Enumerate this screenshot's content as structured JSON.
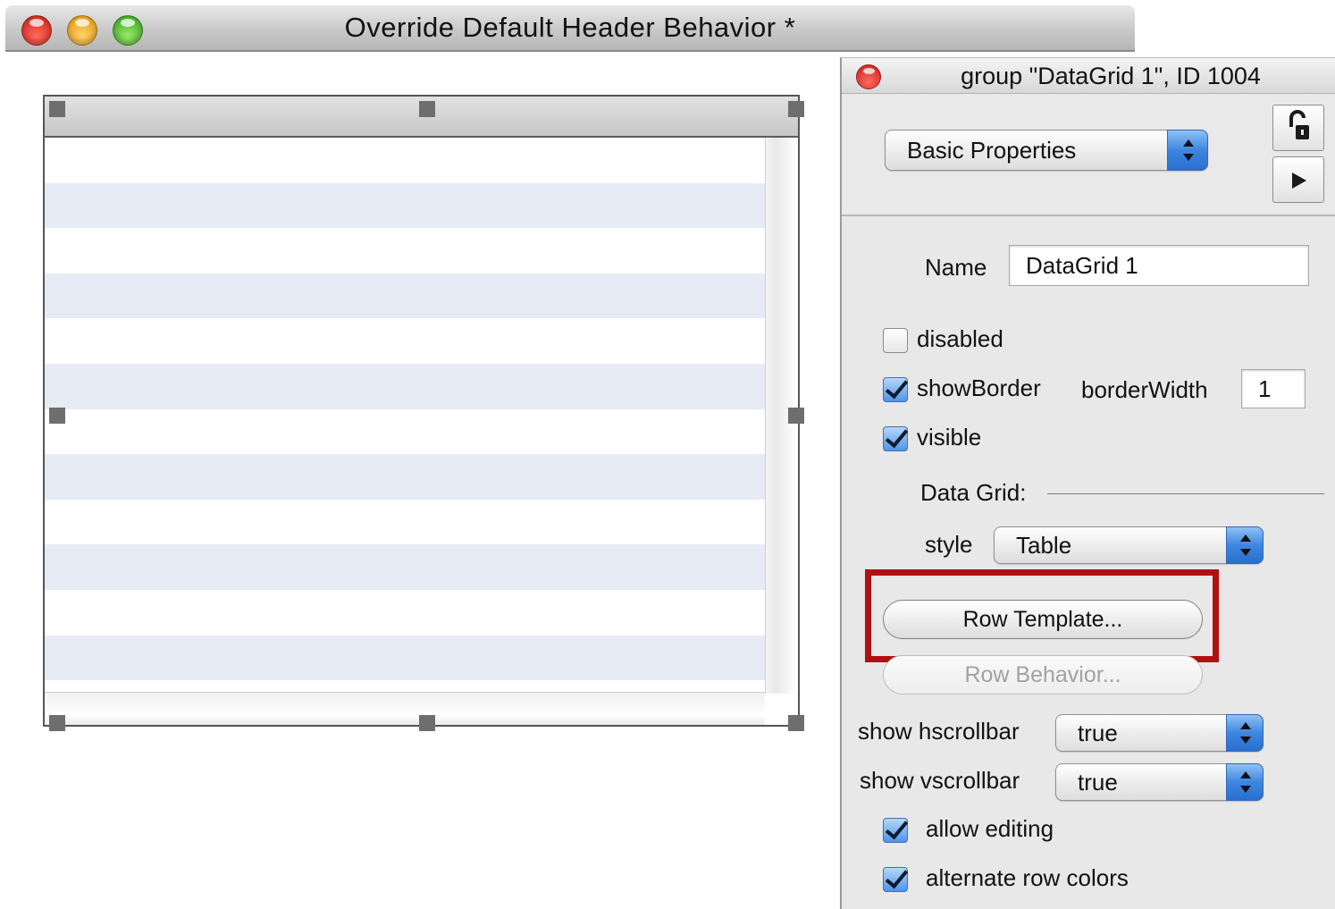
{
  "window": {
    "title": "Override Default Header Behavior *"
  },
  "inspector": {
    "title": "group \"DataGrid 1\", ID 1004",
    "panel_popup": "Basic Properties",
    "lock_icon": "unlock-icon",
    "play_icon": "play-icon",
    "name_label": "Name",
    "name_value": "DataGrid 1",
    "disabled": {
      "label": "disabled",
      "checked": false
    },
    "showBorder": {
      "label": "showBorder",
      "checked": true
    },
    "borderWidth": {
      "label": "borderWidth",
      "value": "1"
    },
    "visible": {
      "label": "visible",
      "checked": true
    },
    "section_label": "Data Grid:",
    "style_label": "style",
    "style_value": "Table",
    "row_template_button": "Row Template...",
    "row_behavior_button": "Row Behavior...",
    "hscrollbar_label": "show hscrollbar",
    "hscrollbar_value": "true",
    "vscrollbar_label": "show vscrollbar",
    "vscrollbar_value": "true",
    "allow_editing": {
      "label": "allow editing",
      "checked": true
    },
    "alternate_row_colors": {
      "label": "alternate row colors",
      "checked": true
    }
  },
  "colors": {
    "alt_row": "#e6ebf5",
    "highlight": "#b10f14",
    "popup_accent": "#3e86e0"
  }
}
